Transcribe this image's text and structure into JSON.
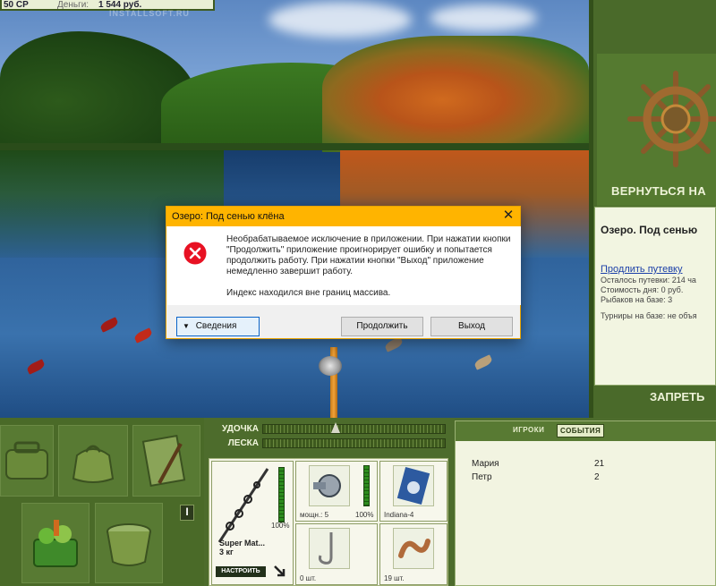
{
  "topbar": {
    "cp": "50 CP",
    "money_label": "Деньги:",
    "money": "1 544 руб.",
    "watermark": "INSTALLSOFT.RU"
  },
  "right_panel": {
    "back_label": "ВЕРНУТЬСЯ НА",
    "lake_title": "Озеро. Под сенью",
    "renew_link": "Продлить путевку",
    "lines": [
      "Осталось путевки: 214 ча",
      "Стоимость дня: 0 руб.",
      "Рыбаков на базе: 3"
    ],
    "tournaments": "Турниры на базе: не объя",
    "forbid_label": "ЗАПРЕТЬ"
  },
  "gauges": [
    {
      "label": "УДОЧКА"
    },
    {
      "label": "ЛЕСКА"
    }
  ],
  "tackle": {
    "rod_percent": "100%",
    "rod_name": "Super Mat...",
    "rod_weight": "3 кг",
    "setup_label": "НАСТРОИТЬ",
    "reel_power": "мощн.: 5",
    "reel_percent": "100%",
    "lure_name": "Indiana-4",
    "hooks_count": "0 шт.",
    "bait_count": "19 шт."
  },
  "players": {
    "tab_players": "ИГРОКИ",
    "tab_events": "СОБЫТИЯ",
    "rows": [
      {
        "name": "Мария",
        "value": "21"
      },
      {
        "name": "Петр",
        "value": "2"
      }
    ]
  },
  "dialog": {
    "title": "Озеро: Под сенью клёна",
    "message": "Необрабатываемое исключение в приложении. При нажатии кнопки \"Продолжить\" приложение проигнорирует ошибку и попытается продолжить работу. При нажатии кнопки \"Выход\" приложение немедленно завершит работу.",
    "message2": "Индекс находился вне границ массива.",
    "details_label": "Сведения",
    "continue_label": "Продолжить",
    "exit_label": "Выход",
    "close_glyph": "✕"
  },
  "info_glyph": "I",
  "colors": {
    "dialog_title": "#ffb400",
    "panel_green": "#4d6c2c",
    "link": "#1b3fa8"
  }
}
